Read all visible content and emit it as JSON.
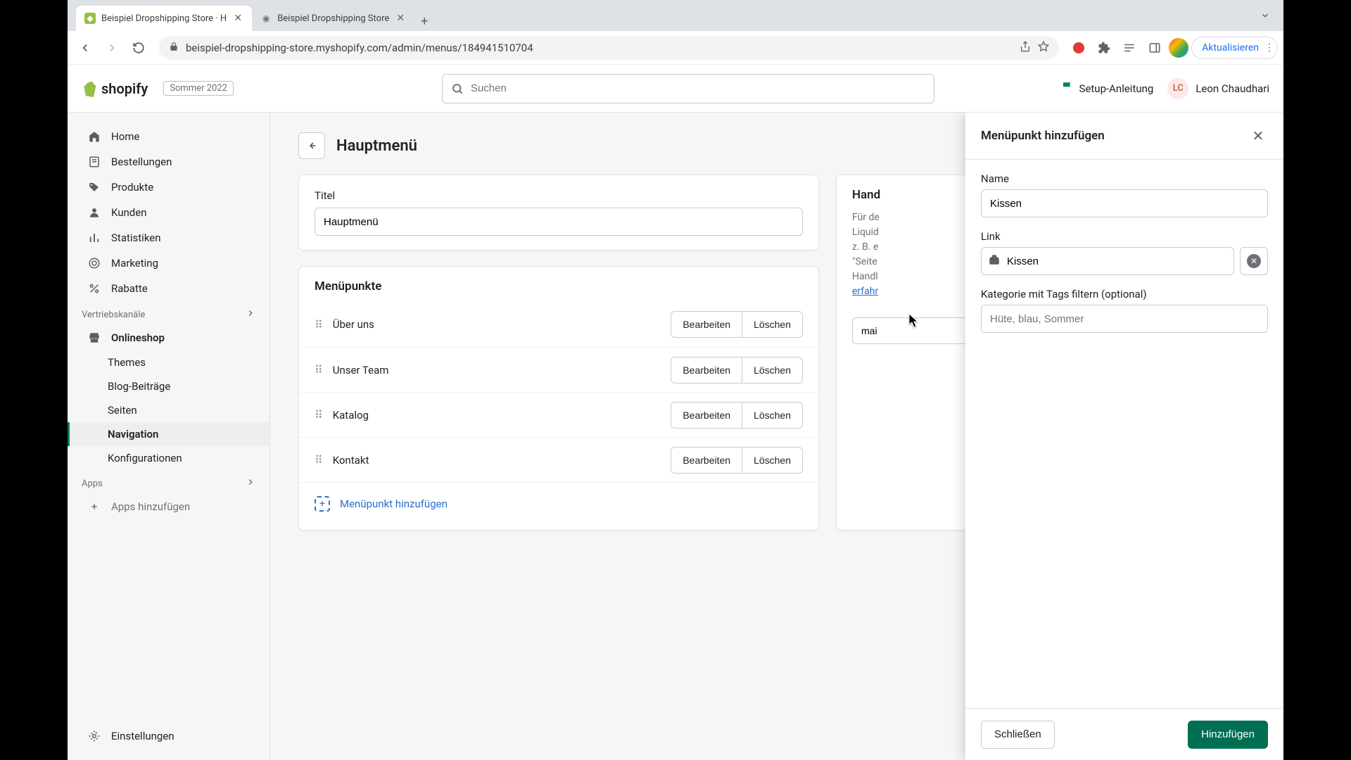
{
  "browser": {
    "tabs": [
      {
        "title": "Beispiel Dropshipping Store · H",
        "favicon_color": "#95bf47"
      },
      {
        "title": "Beispiel Dropshipping Store",
        "favicon_color": "#6d7175"
      }
    ],
    "url": "beispiel-dropshipping-store.myshopify.com/admin/menus/184941510704",
    "update_label": "Aktualisieren"
  },
  "header": {
    "logo_text": "shopify",
    "season": "Sommer 2022",
    "search_placeholder": "Suchen",
    "setup_guide": "Setup-Anleitung",
    "user_initials": "LC",
    "user_name": "Leon Chaudhari"
  },
  "sidebar": {
    "items": [
      {
        "label": "Home"
      },
      {
        "label": "Bestellungen"
      },
      {
        "label": "Produkte"
      },
      {
        "label": "Kunden"
      },
      {
        "label": "Statistiken"
      },
      {
        "label": "Marketing"
      },
      {
        "label": "Rabatte"
      }
    ],
    "channels_label": "Vertriebskanäle",
    "onlineshop": "Onlineshop",
    "onlineshop_sub": [
      {
        "label": "Themes"
      },
      {
        "label": "Blog-Beiträge"
      },
      {
        "label": "Seiten"
      },
      {
        "label": "Navigation"
      },
      {
        "label": "Konfigurationen"
      }
    ],
    "apps_label": "Apps",
    "apps_add": "Apps hinzufügen",
    "settings": "Einstellungen"
  },
  "page": {
    "title": "Hauptmenü",
    "title_field_label": "Titel",
    "title_field_value": "Hauptmenü",
    "menu_section": "Menüpunkte",
    "items": [
      {
        "label": "Über uns"
      },
      {
        "label": "Unser Team"
      },
      {
        "label": "Katalog"
      },
      {
        "label": "Kontakt"
      }
    ],
    "edit_label": "Bearbeiten",
    "delete_label": "Löschen",
    "add_item": "Menüpunkt hinzufügen"
  },
  "side_card": {
    "title": "Hand",
    "body_1": "Für de",
    "body_2": "Liquid",
    "body_3": "z. B. e",
    "body_4": "\"Seite",
    "body_5": "Handl",
    "learn_more": "erfahr",
    "handle_value": "mai"
  },
  "drawer": {
    "title": "Menüpunkt hinzufügen",
    "name_label": "Name",
    "name_value": "Kissen",
    "link_label": "Link",
    "link_value": "Kissen",
    "tags_label": "Kategorie mit Tags filtern (optional)",
    "tags_placeholder": "Hüte, blau, Sommer",
    "close_label": "Schließen",
    "add_label": "Hinzufügen"
  }
}
